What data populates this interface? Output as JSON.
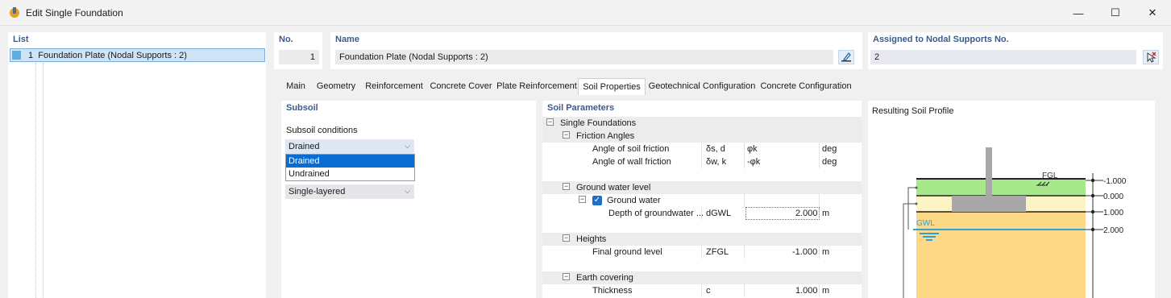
{
  "window": {
    "title": "Edit Single Foundation",
    "minimize": "—",
    "maximize": "☐",
    "close": "✕"
  },
  "list": {
    "header": "List",
    "items": [
      {
        "number": "1",
        "label": "Foundation Plate (Nodal Supports : 2)",
        "color": "#5bb0e0"
      }
    ]
  },
  "no": {
    "header": "No.",
    "value": "1"
  },
  "name": {
    "header": "Name",
    "value": "Foundation Plate (Nodal Supports : 2)"
  },
  "assigned": {
    "header": "Assigned to Nodal Supports No.",
    "value": "2"
  },
  "tabs": [
    {
      "label": "Main"
    },
    {
      "label": "Geometry"
    },
    {
      "label": "Reinforcement"
    },
    {
      "label": "Concrete Cover"
    },
    {
      "label": "Plate Reinforcement"
    },
    {
      "label": "Soil Properties",
      "active": true
    },
    {
      "label": "Geotechnical Configuration"
    },
    {
      "label": "Concrete Configuration"
    }
  ],
  "subsoil": {
    "header": "Subsoil",
    "conditions_label": "Subsoil conditions",
    "conditions_value": "Drained",
    "conditions_options": [
      "Drained",
      "Undrained"
    ],
    "layering_value": "Single-layered"
  },
  "soil_parameters": {
    "header": "Soil Parameters",
    "root": "Single Foundations",
    "friction_angles": {
      "label": "Friction Angles",
      "rows": [
        {
          "name": "Angle of soil friction",
          "symbol": "δs, d",
          "value": "φk",
          "unit": "deg"
        },
        {
          "name": "Angle of wall friction",
          "symbol": "δw, k",
          "value": "-φk",
          "unit": "deg"
        }
      ]
    },
    "ground_water_level": {
      "label": "Ground water level",
      "ground_water": {
        "label": "Ground water",
        "checked": true
      },
      "depth": {
        "name": "Depth of groundwater ...",
        "symbol": "dGWL",
        "value": "2.000",
        "unit": "m"
      }
    },
    "heights": {
      "label": "Heights",
      "final_ground_level": {
        "name": "Final ground level",
        "symbol": "ZFGL",
        "value": "-1.000",
        "unit": "m"
      }
    },
    "earth_covering": {
      "label": "Earth covering",
      "thickness": {
        "name": "Thickness",
        "symbol": "c",
        "value": "1.000",
        "unit": "m"
      }
    }
  },
  "profile": {
    "title": "Resulting Soil Profile",
    "fgl_label": "FGL",
    "gwl_label": "GWL",
    "levels": [
      "-1.000",
      "0.000",
      "1.000",
      "2.000"
    ],
    "colors": {
      "cover": "#a6e88a",
      "foundation_soil": "#fdf3c4",
      "subsoil": "#fdd987",
      "column": "#a8a8a8",
      "water": "#2aa3d8"
    }
  }
}
